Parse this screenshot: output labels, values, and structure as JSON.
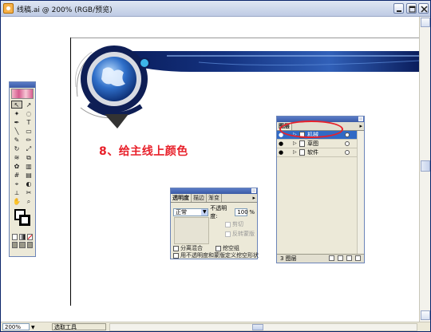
{
  "window": {
    "title": "线稿.ai @ 200% (RGB/预览)"
  },
  "annotation": {
    "text": "8、给主线上颜色",
    "color": "#e8202a"
  },
  "toolbox": {
    "tool_icons": [
      "selection-icon",
      "direct-selection-icon",
      "magic-wand-icon",
      "lasso-icon",
      "pen-icon",
      "type-icon",
      "line-icon",
      "rectangle-icon",
      "paintbrush-icon",
      "pencil-icon",
      "rotate-icon",
      "scale-icon",
      "warp-icon",
      "free-transform-icon",
      "symbol-sprayer-icon",
      "graph-icon",
      "mesh-icon",
      "gradient-icon",
      "eyedropper-icon",
      "blend-icon",
      "slice-icon",
      "scissors-icon",
      "hand-icon",
      "zoom-icon"
    ]
  },
  "transparency_panel": {
    "tabs": [
      "透明度",
      "描边",
      "渐变"
    ],
    "blend_mode": "正常",
    "opacity_label": "不透明度:",
    "opacity_value": "100",
    "opacity_unit": "%",
    "clip_label": "剪切",
    "invert_mask_label": "反转蒙版",
    "isolate_blending_label": "分离混合",
    "knockout_group_label": "挖空组",
    "opacity_mask_label": "用不透明度和蒙版定义挖空形状"
  },
  "layers_panel": {
    "tabs": [
      "图层"
    ],
    "layers": [
      {
        "name": "机械",
        "selected": true
      },
      {
        "name": "草图",
        "selected": false
      },
      {
        "name": "软件",
        "selected": false
      }
    ],
    "footer_count": "3 图层"
  },
  "status_bar": {
    "zoom": "200%",
    "status": "选取工具"
  },
  "colors": {
    "title_bar": "#cbd6ea",
    "selection_blue": "#316ac5",
    "banner_dark": "#0a1d5c",
    "banner_light": "#6fa0e8"
  }
}
